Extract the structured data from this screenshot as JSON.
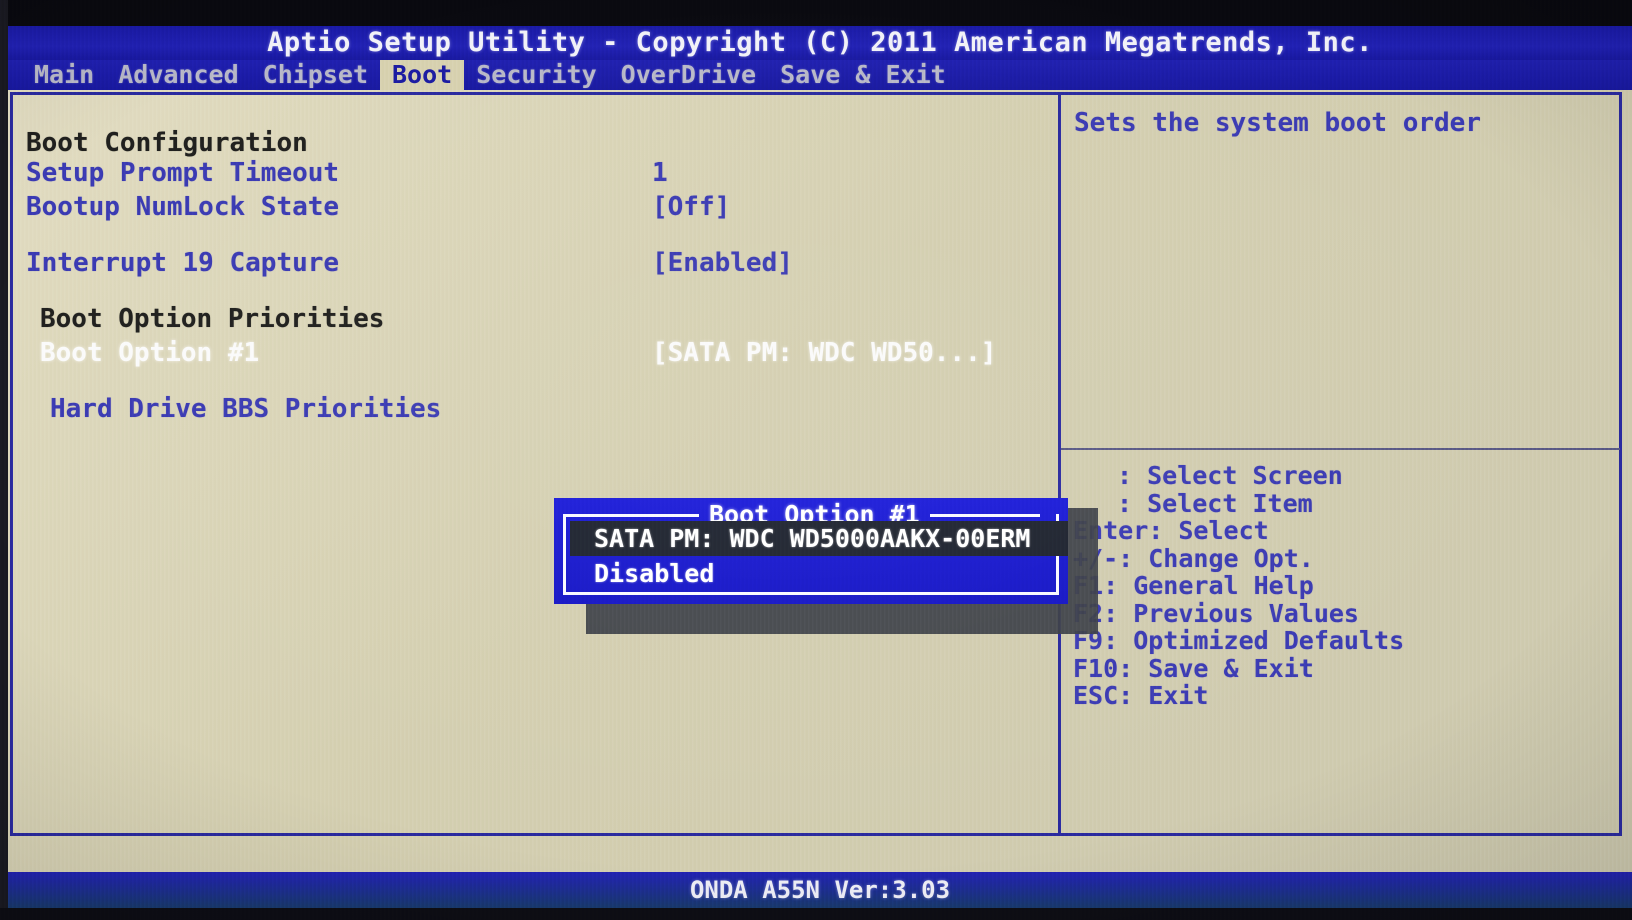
{
  "window": {
    "title": "Aptio Setup Utility - Copyright (C) 2011 American Megatrends, Inc.",
    "status": "ONDA A55N Ver:3.03"
  },
  "colors": {
    "chrome_blue": "#1c1ca8",
    "body_beige": "#d9d4b6",
    "text_blue": "#3b3bb4",
    "text_heading": "#20201e",
    "selected_white": "#fbfbfb",
    "popup_blue": "#1a1ad2",
    "popup_highlight": "#1f2430",
    "active_tab_bg": "#d8d2b0"
  },
  "menu": {
    "tabs": [
      {
        "label": "Main",
        "active": false
      },
      {
        "label": "Advanced",
        "active": false
      },
      {
        "label": "Chipset",
        "active": false
      },
      {
        "label": "Boot",
        "active": true
      },
      {
        "label": "Security",
        "active": false
      },
      {
        "label": "OverDrive",
        "active": false
      },
      {
        "label": "Save & Exit",
        "active": false
      }
    ]
  },
  "settings": {
    "section_heading": "Boot Configuration",
    "rows": [
      {
        "label": "Setup Prompt Timeout",
        "value": "1",
        "selected": false
      },
      {
        "label": "Bootup NumLock State",
        "value": "[Off]",
        "selected": false
      },
      {
        "label": "Interrupt 19 Capture",
        "value": "[Enabled]",
        "selected": false
      }
    ],
    "priorities_heading": "Boot Option Priorities",
    "priority_rows": [
      {
        "label": "Boot Option #1",
        "value": "[SATA  PM: WDC WD50...]",
        "selected": true
      }
    ],
    "submenu": "Hard Drive BBS Priorities"
  },
  "help": {
    "description": "Sets the system boot order",
    "keys": [
      {
        "key": "",
        "text": ": Select Screen",
        "indented": true
      },
      {
        "key": "",
        "text": ": Select Item",
        "indented": true
      },
      {
        "key": "Enter",
        "text": "Enter: Select",
        "indented": false
      },
      {
        "key": "+/-",
        "text": "+/-: Change Opt.",
        "indented": false
      },
      {
        "key": "F1",
        "text": "F1: General Help",
        "indented": false
      },
      {
        "key": "F2",
        "text": "F2: Previous Values",
        "indented": false
      },
      {
        "key": "F9",
        "text": "F9: Optimized Defaults",
        "indented": false
      },
      {
        "key": "F10",
        "text": "F10: Save & Exit",
        "indented": false
      },
      {
        "key": "ESC",
        "text": "ESC: Exit",
        "indented": false
      }
    ]
  },
  "popup": {
    "title": "Boot Option #1",
    "options": [
      {
        "label": "SATA  PM: WDC WD5000AAKX-00ERM",
        "highlighted": true
      },
      {
        "label": "Disabled",
        "highlighted": false
      }
    ]
  }
}
